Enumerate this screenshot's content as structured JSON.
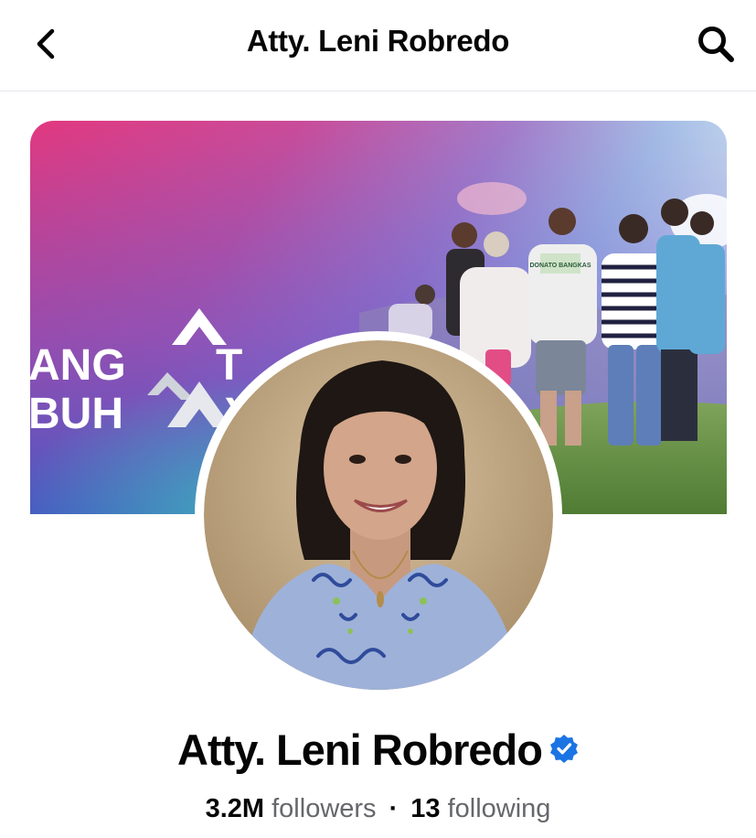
{
  "header": {
    "title": "Atty. Leni Robredo",
    "back_icon": "chevron-left-icon",
    "search_icon": "search-icon"
  },
  "cover": {
    "logo_line1": "ANG",
    "logo_line1_end": "T",
    "logo_line2": "BUH",
    "logo_line2_end": "Y",
    "shirt_text": "DONATO BANGKAS"
  },
  "profile": {
    "name": "Atty. Leni Robredo",
    "verified_color": "#1b74e4",
    "followers_count": "3.2M",
    "followers_label": "followers",
    "separator": "·",
    "following_count": "13",
    "following_label": "following"
  }
}
